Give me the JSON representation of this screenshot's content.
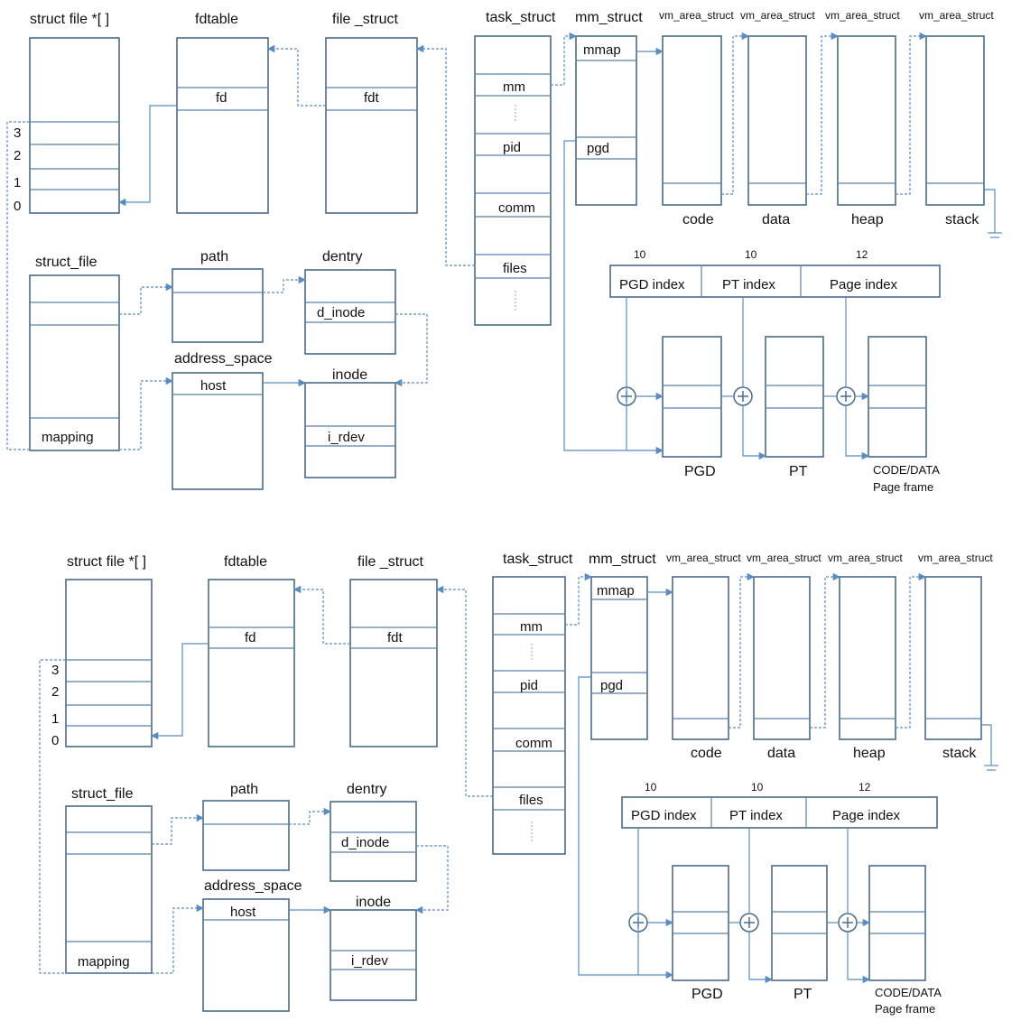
{
  "panels": [
    {
      "titles": {
        "struct_file_array": "struct file *[ ]",
        "fdtable": "fdtable",
        "file_struct": "file _struct",
        "task_struct": "task_struct",
        "mm_struct": "mm_struct",
        "struct_file": "struct_file",
        "path": "path",
        "dentry": "dentry",
        "address_space": "address_space",
        "inode": "inode",
        "vm_area_1": "vm_area_struct",
        "vm_area_2": "vm_area_struct",
        "vm_area_3": "vm_area_struct",
        "vm_area_4": "vm_area_struct"
      },
      "fields": {
        "fd": "fd",
        "fdt": "fdt",
        "mm": "mm",
        "pid": "pid",
        "comm": "comm",
        "files": "files",
        "mmap": "mmap",
        "pgd": "pgd",
        "d_inode": "d_inode",
        "host": "host",
        "i_rdev": "i_rdev",
        "mapping": "mapping"
      },
      "indices": [
        "3",
        "2",
        "1",
        "0"
      ],
      "segments": [
        "code",
        "data",
        "heap",
        "stack"
      ],
      "bits": [
        "10",
        "10",
        "12"
      ],
      "address_fields": [
        "PGD index",
        "PT index",
        "Page index"
      ],
      "tables": {
        "pgd": "PGD",
        "pt": "PT",
        "frame_line1": "CODE/DATA",
        "frame_line2": "Page frame"
      }
    },
    {
      "titles": {
        "struct_file_array": "struct file *[ ]",
        "fdtable": "fdtable",
        "file_struct": "file _struct",
        "task_struct": "task_struct",
        "mm_struct": "mm_struct",
        "struct_file": "struct_file",
        "path": "path",
        "dentry": "dentry",
        "address_space": "address_space",
        "inode": "inode",
        "vm_area_1": "vm_area_struct",
        "vm_area_2": "vm_area_struct",
        "vm_area_3": "vm_area_struct",
        "vm_area_4": "vm_area_struct"
      },
      "fields": {
        "fd": "fd",
        "fdt": "fdt",
        "mm": "mm",
        "pid": "pid",
        "comm": "comm",
        "files": "files",
        "mmap": "mmap",
        "pgd": "pgd",
        "d_inode": "d_inode",
        "host": "host",
        "i_rdev": "i_rdev",
        "mapping": "mapping"
      },
      "indices": [
        "3",
        "2",
        "1",
        "0"
      ],
      "segments": [
        "code",
        "data",
        "heap",
        "stack"
      ],
      "bits": [
        "10",
        "10",
        "12"
      ],
      "address_fields": [
        "PGD index",
        "PT index",
        "Page index"
      ],
      "tables": {
        "pgd": "PGD",
        "pt": "PT",
        "frame_line1": "CODE/DATA",
        "frame_line2": "Page frame"
      }
    }
  ]
}
